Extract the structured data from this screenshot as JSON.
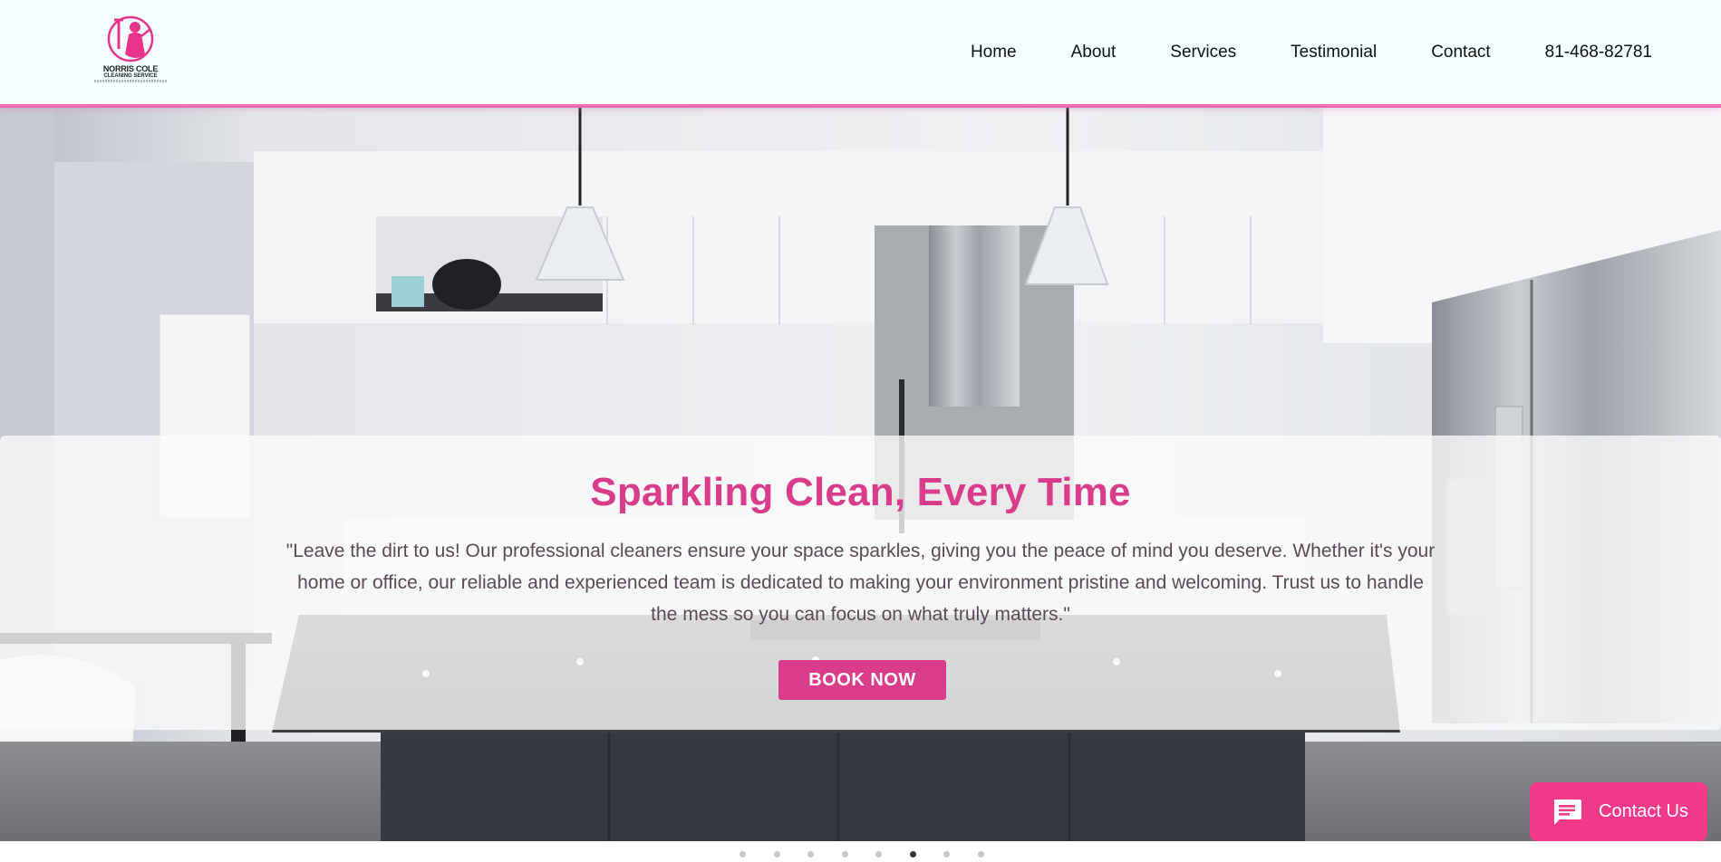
{
  "header": {
    "logo": {
      "name": "NORRIS COLE",
      "subtitle": "CLEANING SERVICE"
    },
    "nav": [
      {
        "label": "Home"
      },
      {
        "label": "About"
      },
      {
        "label": "Services"
      },
      {
        "label": "Testimonial"
      },
      {
        "label": "Contact"
      },
      {
        "label": "81-468-82781"
      }
    ]
  },
  "hero": {
    "title": "Sparkling Clean, Every Time",
    "text": "\"Leave the dirt to us! Our professional cleaners ensure your space sparkles, giving you the peace of mind you deserve. Whether it's your home or office, our reliable and experienced team is dedicated to making your environment pristine and welcoming. Trust us to handle the mess so you can focus on what truly matters.\"",
    "button_label": "BOOK NOW",
    "slider": {
      "total_slides": 8,
      "active_index": 5
    }
  },
  "contact_widget": {
    "label": "Contact Us"
  },
  "colors": {
    "accent": "#d83c8a",
    "widget": "#f2398a",
    "header_bg": "#f2fffe",
    "header_border": "#f06fb4"
  },
  "icons": {
    "chat": "chat-bubble-icon"
  }
}
